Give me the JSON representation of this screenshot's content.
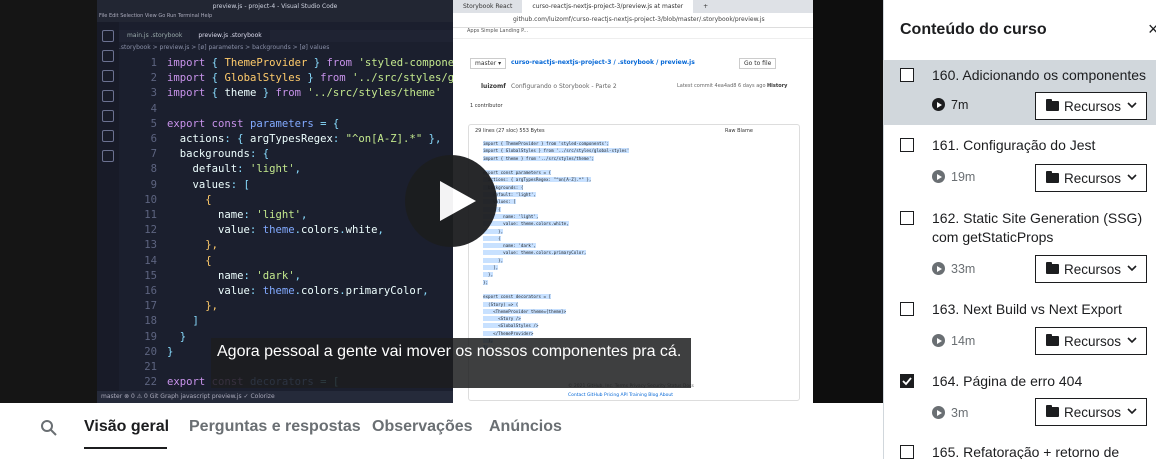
{
  "video": {
    "vscode_title": "preview.js - project-4 - Visual Studio Code",
    "vscode_menu": "File  Edit  Selection  View  Go  Run  Terminal  Help",
    "vscode_tabs": [
      "main.js .storybook",
      "preview.js .storybook"
    ],
    "vscode_breadcrumb": ".storybook > preview.js > [ø] parameters > backgrounds > [ø] values",
    "vscode_status": "master    ⊗ 0 ⚠ 0    Git Graph       javascript   preview.js    ✓ Colorize",
    "browser_tabs": [
      "Storybook React",
      "curso-reactjs-nextjs-project-3/preview.js at master",
      "+"
    ],
    "browser_url": "github.com/luizomf/curso-reactjs-nextjs-project-3/blob/master/.storybook/preview.js",
    "browser_bookmarks": "Apps    Simple Landing P...",
    "gh_branch": "master ▾",
    "gh_path": "curso-reactjs-nextjs-project-3 / .storybook / preview.js",
    "gh_goto": "Go to file",
    "gh_commit_user": "luizomf",
    "gh_commit_msg": "Configurando o Storybook - Parte 2",
    "gh_latest": "Latest commit 4ea4ad8 6 days ago",
    "gh_history": "History",
    "gh_contrib": "1 contributor",
    "gh_fileinfo": "29 lines (27 sloc)   553 Bytes",
    "gh_raw": "Raw   Blame",
    "gh_footer": "© 2021 GitHub, Inc.   Terms   Privacy   Security   Status   Docs",
    "gh_footer2": "Contact GitHub   Pricing   API   Training   Blog   About",
    "caption": "Agora pessoal a gente vai mover os nossos componentes pra cá."
  },
  "tabs": {
    "items": [
      "Visão geral",
      "Perguntas e respostas",
      "Observações",
      "Anúncios"
    ]
  },
  "sidebar": {
    "title": "Conteúdo do curso",
    "close": "×",
    "resources_label": "Recursos",
    "items": [
      {
        "title": "160. Adicionando os componentes",
        "duration": "7m",
        "checked": false,
        "current": true
      },
      {
        "title": "161. Configuração do Jest",
        "duration": "19m",
        "checked": false,
        "current": false
      },
      {
        "title": "162. Static Site Generation (SSG) com getStaticProps",
        "duration": "33m",
        "checked": false,
        "current": false
      },
      {
        "title": "163. Next Build vs Next Export",
        "duration": "14m",
        "checked": false,
        "current": false
      },
      {
        "title": "164. Página de erro 404",
        "duration": "3m",
        "checked": true,
        "current": false
      },
      {
        "title": "165. Refatoração + retorno de",
        "duration": "",
        "checked": false,
        "current": false
      }
    ]
  }
}
